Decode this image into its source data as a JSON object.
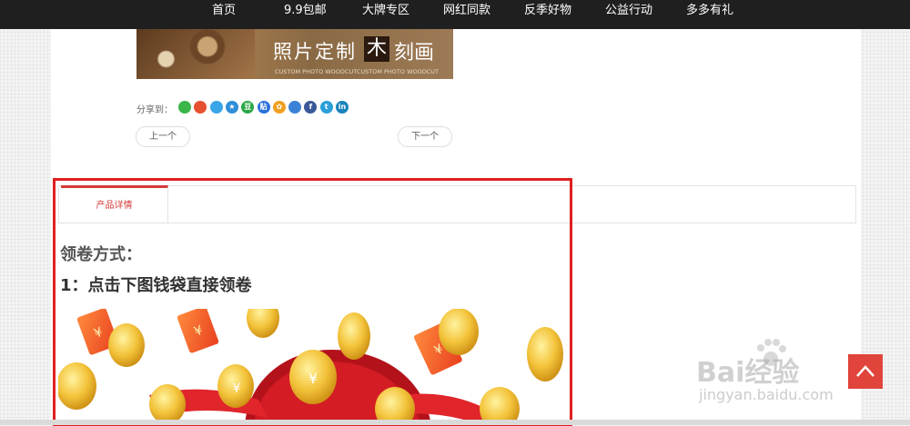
{
  "nav": {
    "items": [
      {
        "label": "首页"
      },
      {
        "label": "9.9包邮"
      },
      {
        "label": "大牌专区"
      },
      {
        "label": "网红同款"
      },
      {
        "label": "反季好物"
      },
      {
        "label": "公益行动"
      },
      {
        "label": "多多有礼"
      }
    ]
  },
  "banner": {
    "title_a": "照片定制",
    "title_b": "木",
    "title_c": "刻画",
    "caption": "CUSTOM PHOTO WOODCUTCUSTOM PHOTO WOODCUT"
  },
  "share": {
    "label": "分享到：",
    "icons": [
      {
        "name": "wechat-icon",
        "glyph": "",
        "color": "#3bb54a"
      },
      {
        "name": "weibo-icon",
        "glyph": "",
        "color": "#e6502f"
      },
      {
        "name": "qq-icon",
        "glyph": "",
        "color": "#3aa5e8"
      },
      {
        "name": "qzone-icon",
        "glyph": "★",
        "color": "#2f8fd8"
      },
      {
        "name": "douban-icon",
        "glyph": "豆",
        "color": "#28a745"
      },
      {
        "name": "tieba-icon",
        "glyph": "贴",
        "color": "#2a6fdb"
      },
      {
        "name": "flower-icon",
        "glyph": "✿",
        "color": "#f0a020"
      },
      {
        "name": "copy-icon",
        "glyph": "",
        "color": "#3b82d6"
      },
      {
        "name": "facebook-icon",
        "glyph": "f",
        "color": "#3b5998"
      },
      {
        "name": "tumblr-icon",
        "glyph": "t",
        "color": "#2c9fd8"
      },
      {
        "name": "linkedin-icon",
        "glyph": "in",
        "color": "#1a84bc"
      }
    ]
  },
  "pager": {
    "prev": "上一个",
    "next": "下一个"
  },
  "tabs": {
    "active": "产品详情"
  },
  "content": {
    "heading1": "领卷方式：",
    "heading2": "1：点击下图钱袋直接领卷"
  },
  "watermark": {
    "logo": "Bai经验",
    "url": "jingyan.baidu.com"
  },
  "colors": {
    "accent": "#d63a3a",
    "highlight": "#e02020",
    "nav_bg": "#1f1f1f"
  }
}
